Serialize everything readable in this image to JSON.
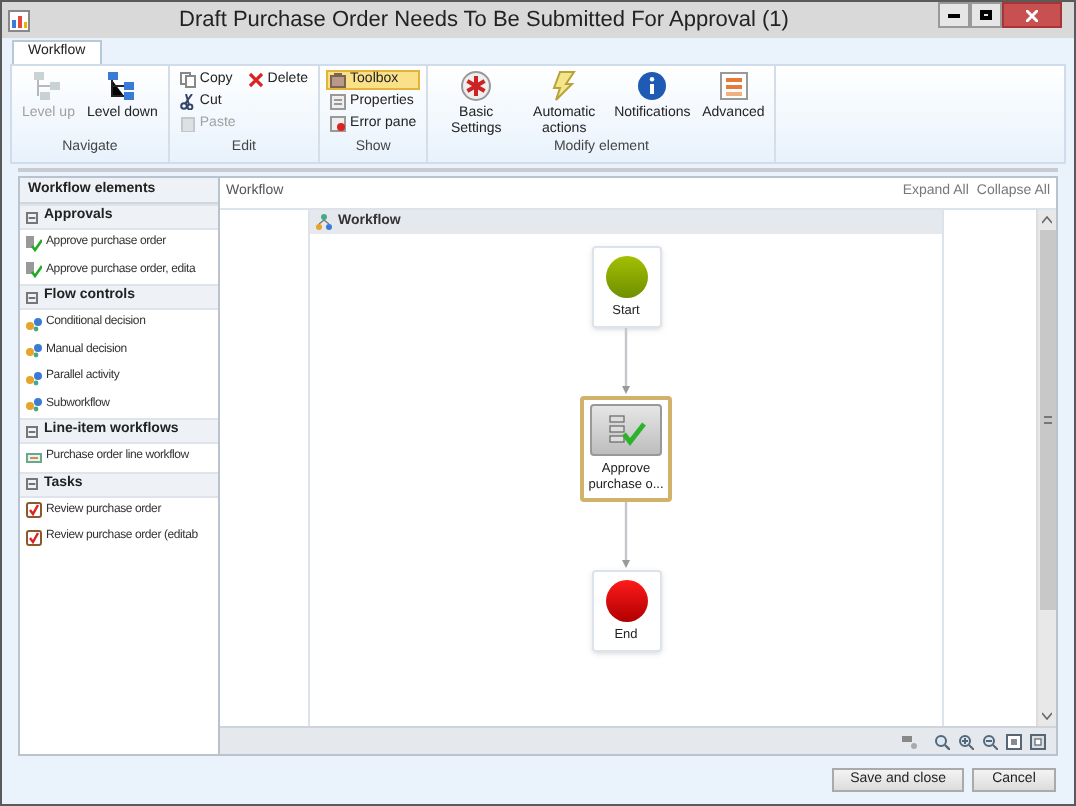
{
  "window": {
    "title": "Draft Purchase Order Needs To Be Submitted For Approval (1)"
  },
  "tabs": [
    {
      "label": "Workflow",
      "selected": true
    }
  ],
  "ribbon": [
    {
      "label": "Navigate",
      "items": [
        {
          "kind": "large",
          "label": "Level up",
          "disabled": true
        },
        {
          "kind": "large",
          "label": "Level down",
          "disabled": false
        }
      ]
    },
    {
      "label": "Edit",
      "items": [
        {
          "kind": "small",
          "label": "Copy",
          "disabled": false
        },
        {
          "kind": "small",
          "label": "Cut",
          "disabled": false
        },
        {
          "kind": "small",
          "label": "Paste",
          "disabled": true
        },
        {
          "kind": "small",
          "label": "Delete",
          "disabled": false
        }
      ]
    },
    {
      "label": "Show",
      "items": [
        {
          "kind": "small",
          "label": "Toolbox",
          "selected": true
        },
        {
          "kind": "small",
          "label": "Properties",
          "selected": false
        },
        {
          "kind": "small",
          "label": "Error pane",
          "selected": false
        }
      ]
    },
    {
      "label": "Modify element",
      "items": [
        {
          "kind": "large",
          "label": "Basic Settings",
          "disabled": false
        },
        {
          "kind": "large",
          "label": "Automatic actions",
          "disabled": false
        },
        {
          "kind": "large",
          "label": "Notifications",
          "disabled": false
        },
        {
          "kind": "large",
          "label": "Advanced",
          "disabled": false
        }
      ]
    }
  ],
  "elements_panel": {
    "title": "Workflow elements",
    "groups": [
      {
        "label": "Approvals",
        "expanded": true,
        "items": [
          "Approve purchase order",
          "Approve purchase order, edita"
        ]
      },
      {
        "label": "Flow controls",
        "expanded": true,
        "items": [
          "Conditional decision",
          "Manual decision",
          "Parallel activity",
          "Subworkflow"
        ]
      },
      {
        "label": "Line-item workflows",
        "expanded": true,
        "items": [
          "Purchase order line workflow"
        ]
      },
      {
        "label": "Tasks",
        "expanded": true,
        "items": [
          "Review purchase order",
          "Review purchase order (editab"
        ]
      }
    ]
  },
  "canvas": {
    "breadcrumb": "Workflow",
    "links": [
      "Expand All",
      "Collapse All"
    ],
    "container_title": "Workflow",
    "nodes": [
      {
        "kind": "start",
        "label": "Start",
        "selected": false
      },
      {
        "kind": "task",
        "label": "Approve purchase o...",
        "selected": true
      },
      {
        "kind": "end",
        "label": "End",
        "selected": false
      }
    ]
  },
  "buttons": [
    "Save and close",
    "Cancel"
  ]
}
